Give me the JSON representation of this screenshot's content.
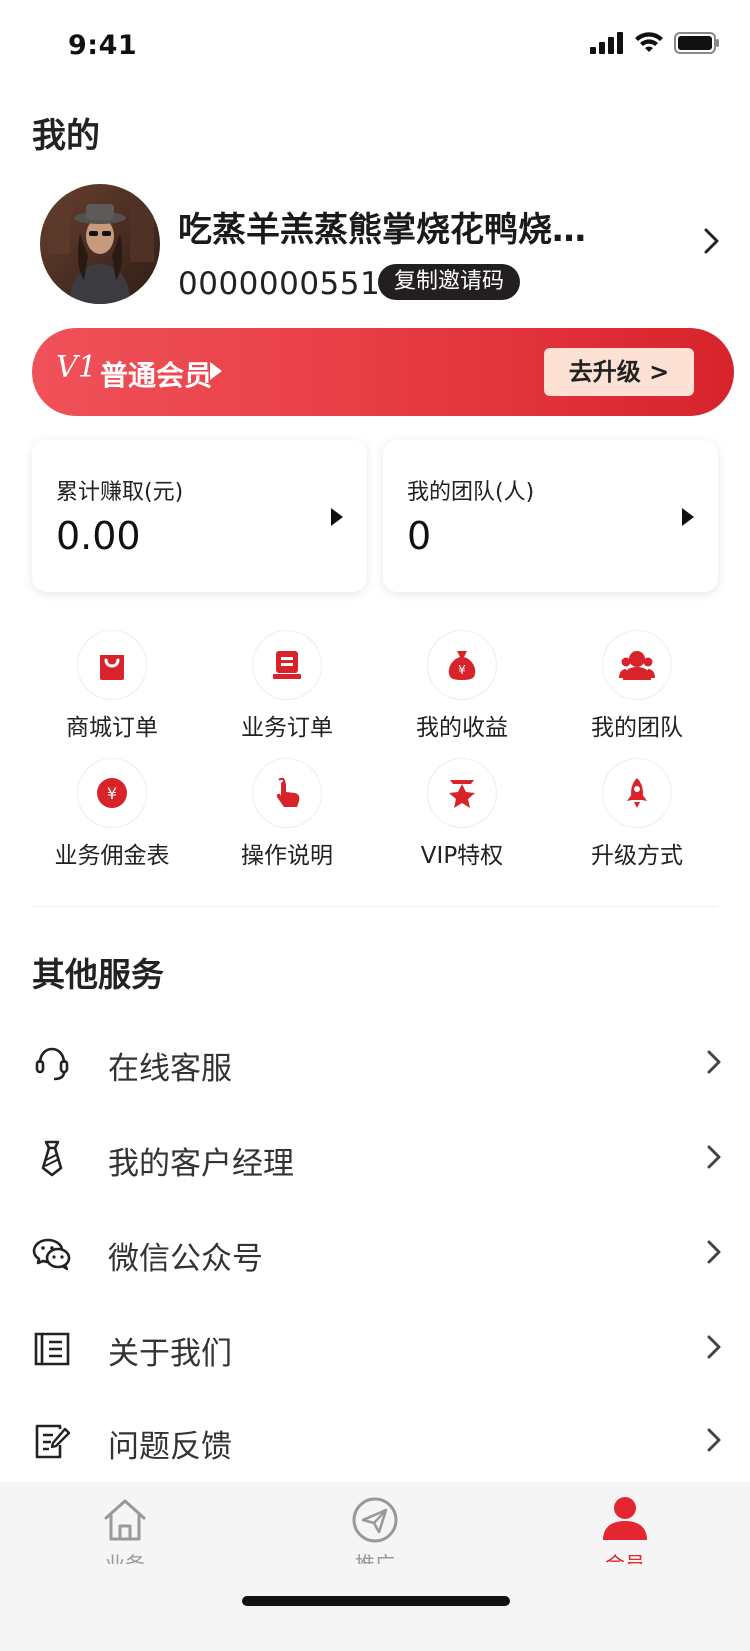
{
  "status_bar": {
    "time": "9:41"
  },
  "header": {
    "title": "我的"
  },
  "profile": {
    "nickname": "吃蒸羊羔蒸熊掌烧花鸭烧雏鸡",
    "user_id": "0000000551",
    "copy_invite_label": "复制邀请码"
  },
  "membership": {
    "level": "V1",
    "label": "普通会员",
    "upgrade_label": "去升级 >"
  },
  "stats": [
    {
      "label": "累计赚取(元)",
      "value": "0.00"
    },
    {
      "label": "我的团队(人)",
      "value": "0"
    }
  ],
  "grid": [
    {
      "label": "商城订单",
      "icon": "shopping-bag-icon"
    },
    {
      "label": "业务订单",
      "icon": "document-icon"
    },
    {
      "label": "我的收益",
      "icon": "money-bag-icon"
    },
    {
      "label": "我的团队",
      "icon": "team-icon"
    },
    {
      "label": "业务佣金表",
      "icon": "yuan-coin-icon"
    },
    {
      "label": "操作说明",
      "icon": "hand-pointer-icon"
    },
    {
      "label": "VIP特权",
      "icon": "star-badge-icon"
    },
    {
      "label": "升级方式",
      "icon": "rocket-icon"
    }
  ],
  "services": {
    "title": "其他服务",
    "items": [
      {
        "label": "在线客服",
        "icon": "headset-icon"
      },
      {
        "label": "我的客户经理",
        "icon": "tie-icon"
      },
      {
        "label": "微信公众号",
        "icon": "wechat-icon"
      },
      {
        "label": "关于我们",
        "icon": "book-icon"
      },
      {
        "label": "问题反馈",
        "icon": "edit-note-icon"
      }
    ]
  },
  "tabbar": {
    "items": [
      {
        "label": "业务",
        "icon": "home-icon",
        "active": false
      },
      {
        "label": "推广",
        "icon": "paper-plane-icon",
        "active": false
      },
      {
        "label": "会员",
        "icon": "user-icon",
        "active": true
      }
    ]
  },
  "colors": {
    "accent": "#e3262f",
    "icon_red": "#d9232b",
    "upgrade_bg": "#fde1d4",
    "tab_inactive": "#999999"
  }
}
